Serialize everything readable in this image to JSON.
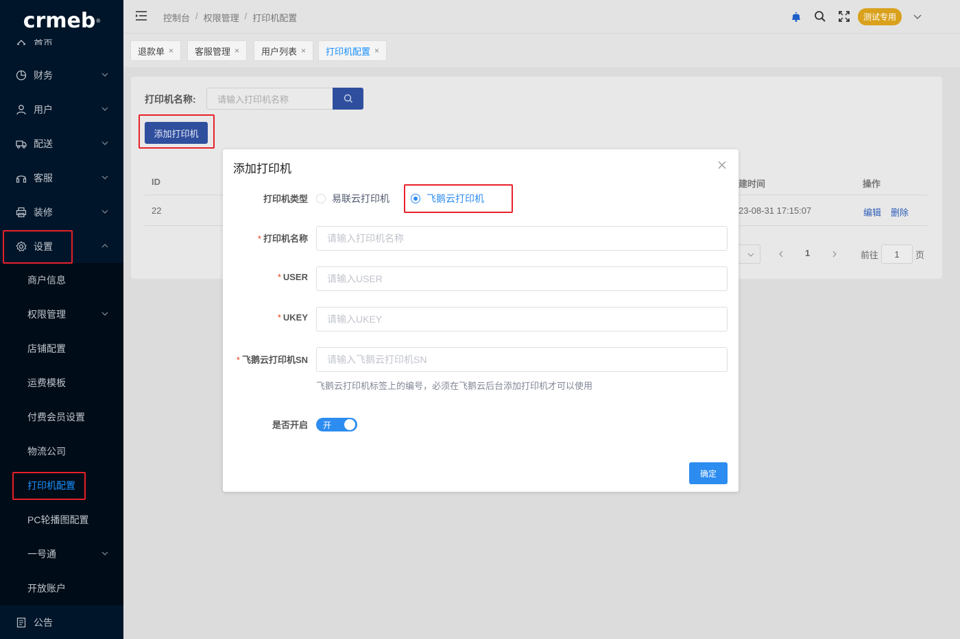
{
  "logo": {
    "text": "crmeb",
    "mark": "®"
  },
  "sidebar": {
    "items": [
      {
        "label": "首页"
      },
      {
        "label": "财务"
      },
      {
        "label": "用户"
      },
      {
        "label": "配送"
      },
      {
        "label": "客服"
      },
      {
        "label": "装修"
      },
      {
        "label": "设置"
      },
      {
        "label": "公告"
      }
    ],
    "sub_items": [
      {
        "label": "商户信息"
      },
      {
        "label": "权限管理"
      },
      {
        "label": "店铺配置"
      },
      {
        "label": "运费模板"
      },
      {
        "label": "付费会员设置"
      },
      {
        "label": "物流公司"
      },
      {
        "label": "打印机配置"
      },
      {
        "label": "PC轮播图配置"
      },
      {
        "label": "一号通"
      },
      {
        "label": "开放账户"
      }
    ]
  },
  "header": {
    "breadcrumbs": [
      "控制台",
      "权限管理",
      "打印机配置"
    ],
    "separator": "/",
    "user_label": "测试专用"
  },
  "tags": [
    {
      "label": "退款单",
      "close": "×"
    },
    {
      "label": "客服管理",
      "close": "×"
    },
    {
      "label": "用户列表",
      "close": "×"
    },
    {
      "label": "打印机配置",
      "close": "×"
    }
  ],
  "page": {
    "search_label": "打印机名称:",
    "search_placeholder": "请输入打印机名称",
    "add_button": "添加打印机",
    "table": {
      "headers": {
        "id": "ID",
        "created": "建时间",
        "actions": "操作"
      },
      "row": {
        "id": "22",
        "created": "23-08-31 17:15:07",
        "edit": "编辑",
        "delete": "删除"
      }
    },
    "pager": {
      "current": "1",
      "goto_label": "前往",
      "goto_value": "1",
      "page_suffix": "页"
    }
  },
  "modal": {
    "title": "添加打印机",
    "type_label": "打印机类型",
    "type_options": [
      "易联云打印机",
      "飞鹅云打印机"
    ],
    "type_selected": "飞鹅云打印机",
    "fields": {
      "name": {
        "label": "打印机名称",
        "placeholder": "请输入打印机名称"
      },
      "user": {
        "label": "USER",
        "placeholder": "请输入USER"
      },
      "ukey": {
        "label": "UKEY",
        "placeholder": "请输入UKEY"
      },
      "sn": {
        "label": "飞鹅云打印机SN",
        "placeholder": "请输入飞鹅云打印机SN"
      }
    },
    "required_mark": "*",
    "sn_hint": "飞鹅云打印机标签上的编号，必须在飞鹅云后台添加打印机才可以使用",
    "enable_label": "是否开启",
    "enable_state": "开",
    "confirm_button": "确定"
  },
  "colors": {
    "sidebar_bg": "#001529",
    "primary": "#2d8cf0",
    "highlight": "#e8202a",
    "badge": "#d9a11c"
  }
}
